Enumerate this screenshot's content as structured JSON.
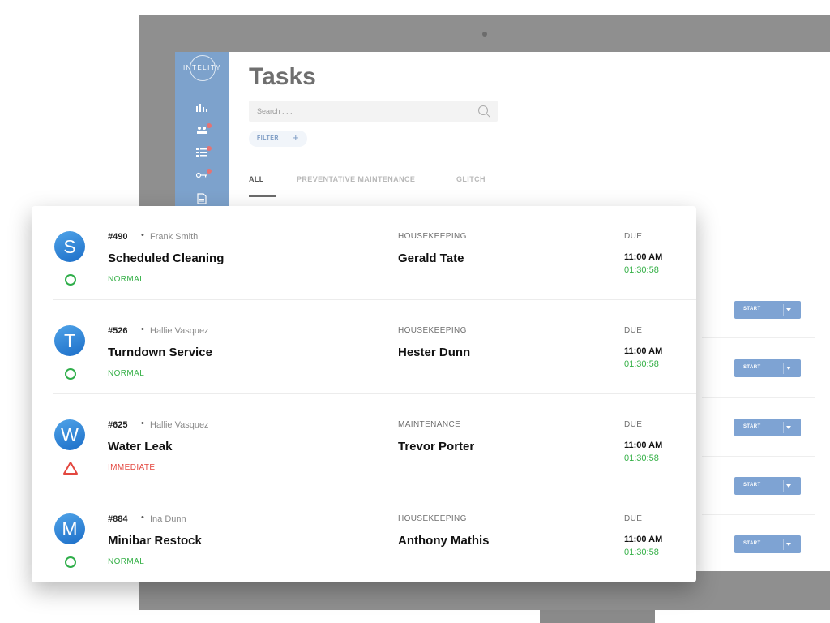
{
  "app": {
    "logo_text": "INTELITY",
    "title": "Tasks"
  },
  "search": {
    "placeholder": "Search . . ."
  },
  "filter": {
    "label": "FILTER"
  },
  "tabs": [
    {
      "label": "ALL",
      "active": true
    },
    {
      "label": "PREVENTATIVE MAINTENANCE",
      "active": false
    },
    {
      "label": "GLITCH",
      "active": false
    }
  ],
  "sidebar": {
    "icons": [
      "bar-chart-icon",
      "people-icon",
      "checklist-icon",
      "key-icon",
      "document-icon"
    ],
    "badge_color": "#e57373"
  },
  "start_buttons": {
    "label": "START",
    "count": 5
  },
  "tasks": [
    {
      "avatar_letter": "S",
      "number": "#490",
      "person": "Frank Smith",
      "title": "Scheduled Cleaning",
      "priority": "NORMAL",
      "department": "HOUSEKEEPING",
      "assignee": "Gerald Tate",
      "due_label": "DUE",
      "due_time": "11:00 AM",
      "countdown": "01:30:58"
    },
    {
      "avatar_letter": "T",
      "number": "#526",
      "person": "Hallie Vasquez",
      "title": "Turndown Service",
      "priority": "NORMAL",
      "department": "HOUSEKEEPING",
      "assignee": "Hester Dunn",
      "due_label": "DUE",
      "due_time": "11:00 AM",
      "countdown": "01:30:58"
    },
    {
      "avatar_letter": "W",
      "number": "#625",
      "person": "Hallie Vasquez",
      "title": "Water Leak",
      "priority": "IMMEDIATE",
      "department": "MAINTENANCE",
      "assignee": "Trevor Porter",
      "due_label": "DUE",
      "due_time": "11:00 AM",
      "countdown": "01:30:58"
    },
    {
      "avatar_letter": "M",
      "number": "#884",
      "person": "Ina Dunn",
      "title": "Minibar Restock",
      "priority": "NORMAL",
      "department": "HOUSEKEEPING",
      "assignee": "Anthony Mathis",
      "due_label": "DUE",
      "due_time": "11:00 AM",
      "countdown": "01:30:58"
    }
  ],
  "colors": {
    "sidebar": "#7da2cc",
    "accent": "#7ea3d3",
    "normal": "#35b047",
    "immediate": "#e3473f",
    "avatar": "#2a7fd6"
  }
}
